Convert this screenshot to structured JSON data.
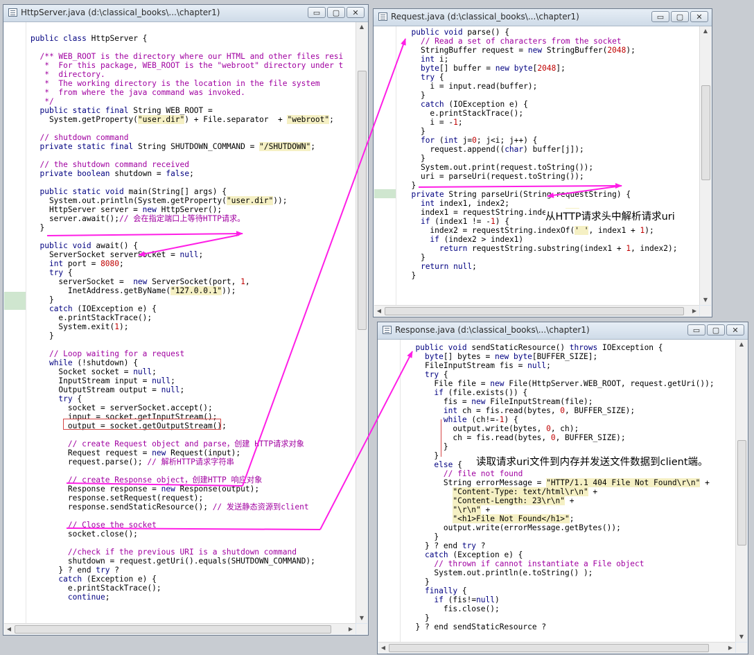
{
  "colors": {
    "keyword": "#000080",
    "string": "#000000",
    "string_bg": "#f5f0c4",
    "number": "#c00000",
    "comment": "#a000a0",
    "identifier": "#006e6e",
    "arrow": "#ff1ee6"
  },
  "window_buttons": {
    "minimize": "▭",
    "maximize": "▢",
    "close": "✕"
  },
  "windows": {
    "httpserver": {
      "title": "HttpServer.java (d:\\classical_books\\...\\chapter1)",
      "icon": "java-file-icon",
      "lines": [
        "",
        "public class HttpServer {",
        "",
        "  /** WEB_ROOT is the directory where our HTML and other files resi",
        "   *  For this package, WEB_ROOT is the \"webroot\" directory under t",
        "   *  directory.",
        "   *  The working directory is the location in the file system",
        "   *  from where the java command was invoked.",
        "   */",
        "  public static final String WEB_ROOT =",
        "    System.getProperty(\"user.dir\") + File.separator  + \"webroot\";",
        "",
        "  // shutdown command",
        "  private static final String SHUTDOWN_COMMAND = \"/SHUTDOWN\";",
        "",
        "  // the shutdown command received",
        "  private boolean shutdown = false;",
        "",
        "  public static void main(String[] args) {",
        "    System.out.println(System.getProperty(\"user.dir\"));",
        "    HttpServer server = new HttpServer();",
        "    server.await();// 会在指定端口上等待HTTP请求。",
        "  }",
        "",
        "  public void await() {",
        "    ServerSocket serverSocket = null;",
        "    int port = 8080;",
        "    try {",
        "      serverSocket =  new ServerSocket(port, 1,",
        "        InetAddress.getByName(\"127.0.0.1\"));",
        "    }",
        "    catch (IOException e) {",
        "      e.printStackTrace();",
        "      System.exit(1);",
        "    }",
        "",
        "    // Loop waiting for a request",
        "    while (!shutdown) {",
        "      Socket socket = null;",
        "      InputStream input = null;",
        "      OutputStream output = null;",
        "      try {",
        "        socket = serverSocket.accept();",
        "        input = socket.getInputStream();",
        "        output = socket.getOutputStream();",
        "",
        "        // create Request object and parse，创建 HTTP请求对象",
        "        Request request = new Request(input);",
        "        request.parse(); // 解析HTTP请求字符串",
        "",
        "        // create Response object，创建HTTP 响应对象",
        "        Response response = new Response(output);",
        "        response.setRequest(request);",
        "        response.sendStaticResource(); // 发送静态资源到client",
        "",
        "        // Close the socket",
        "        socket.close();",
        "",
        "        //check if the previous URI is a shutdown command",
        "        shutdown = request.getUri().equals(SHUTDOWN_COMMAND);",
        "      } ? end try ?",
        "      catch (Exception e) {",
        "        e.printStackTrace();",
        "        continue;"
      ]
    },
    "request": {
      "title": "Request.java (d:\\classical_books\\...\\chapter1)",
      "icon": "java-file-icon",
      "lines": [
        "  public void parse() {",
        "    // Read a set of characters from the socket",
        "    StringBuffer request = new StringBuffer(2048);",
        "    int i;",
        "    byte[] buffer = new byte[2048];",
        "    try {",
        "      i = input.read(buffer);",
        "    }",
        "    catch (IOException e) {",
        "      e.printStackTrace();",
        "      i = -1;",
        "    }",
        "    for (int j=0; j<i; j++) {",
        "      request.append((char) buffer[j]);",
        "    }",
        "    System.out.print(request.toString());",
        "    uri = parseUri(request.toString());",
        "  }",
        "  private String parseUri(String requestString) {",
        "    int index1, index2;",
        "    index1 = requestString.indexOf(' ');",
        "    if (index1 != -1) {",
        "      index2 = requestString.indexOf(' ', index1 + 1);",
        "      if (index2 > index1)",
        "        return requestString.substring(index1 + 1, index2);",
        "    }",
        "    return null;",
        "  }"
      ]
    },
    "response": {
      "title": "Response.java (d:\\classical_books\\...\\chapter1)",
      "icon": "java-file-icon",
      "lines": [
        "  public void sendStaticResource() throws IOException {",
        "    byte[] bytes = new byte[BUFFER_SIZE];",
        "    FileInputStream fis = null;",
        "    try {",
        "      File file = new File(HttpServer.WEB_ROOT, request.getUri());",
        "      if (file.exists()) {",
        "        fis = new FileInputStream(file);",
        "        int ch = fis.read(bytes, 0, BUFFER_SIZE);",
        "        while (ch!=-1) {",
        "          output.write(bytes, 0, ch);",
        "          ch = fis.read(bytes, 0, BUFFER_SIZE);",
        "        }",
        "      }",
        "      else {",
        "        // file not found",
        "        String errorMessage = \"HTTP/1.1 404 File Not Found\\r\\n\" +",
        "          \"Content-Type: text/html\\r\\n\" +",
        "          \"Content-Length: 23\\r\\n\" +",
        "          \"\\r\\n\" +",
        "          \"<h1>File Not Found</h1>\";",
        "        output.write(errorMessage.getBytes());",
        "      }",
        "    } ? end try ?",
        "    catch (Exception e) {",
        "      // thrown if cannot instantiate a File object",
        "      System.out.println(e.toString() );",
        "    }",
        "    finally {",
        "      if (fis!=null)",
        "        fis.close();",
        "    }",
        "  } ? end sendStaticResource ?"
      ]
    }
  },
  "annotations": {
    "parse_uri_note": "从HTTP请求头中解析请求uri",
    "send_resource_note": "读取请求uri文件到内存并发送文件数据到client端。"
  }
}
